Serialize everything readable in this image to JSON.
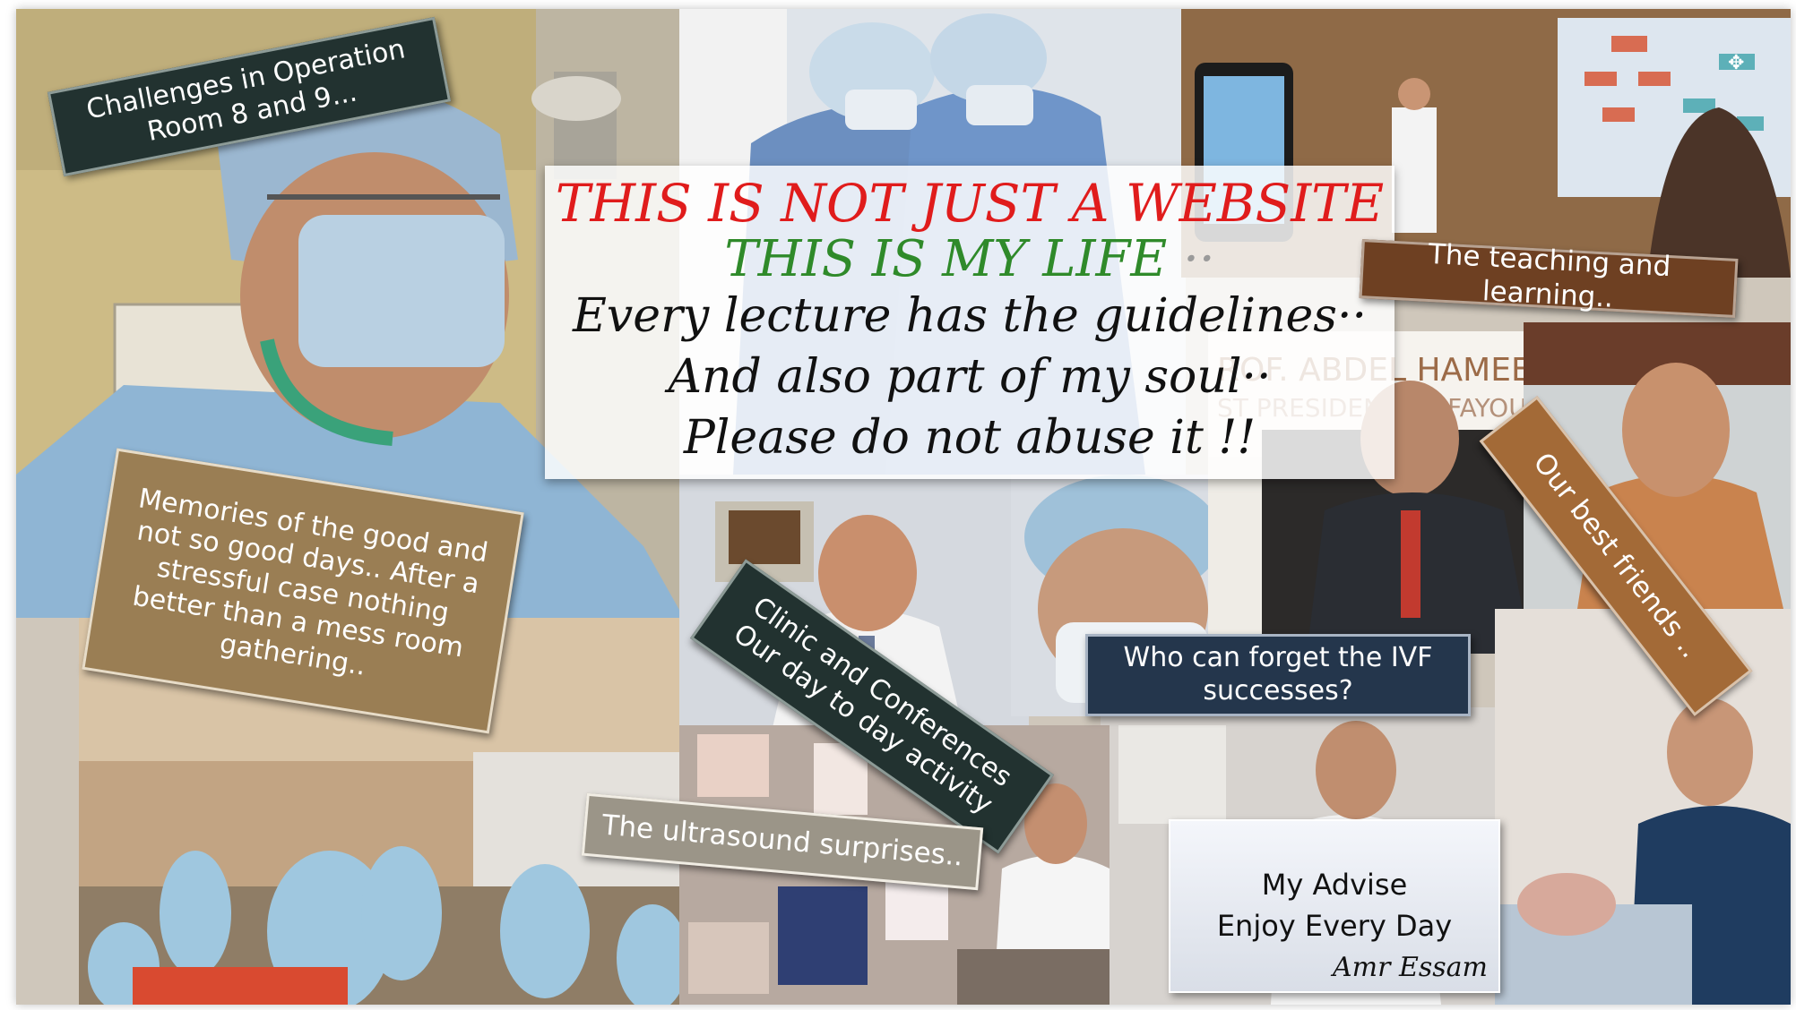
{
  "headline": {
    "line1": "THIS IS NOT JUST A WEBSITE",
    "line2": "THIS IS MY LIFE",
    "line2_dots": "··",
    "line3": "Every lecture has the guidelines··",
    "line4": "And also part of my soul··",
    "line5": "Please do not abuse it !!",
    "colors": {
      "line1": "#e01c1c",
      "line2": "#2f8a2a",
      "body": "#111111"
    }
  },
  "captions": {
    "operation_room": "Challenges in Operation Room 8 and 9...",
    "teaching": "The teaching and learning..",
    "memories": "Memories of the good and not so good days.. After a stressful case nothing better than a mess room gathering..",
    "friends": "Our best friends ..",
    "clinic": "Clinic and Conferences Our day to day activity",
    "ivf": "Who can forget the IVF successes?",
    "ultrasound": "The ultrasound surprises.."
  },
  "advise": {
    "line1": "My Advise",
    "line2": "Enjoy Every Day",
    "signature": "Amr Essam"
  },
  "background_text": {
    "banner_fragment_1": "ROF. ABDEL HAMEED ABD",
    "banner_fragment_2": "ST PRESIDENT OF FAYOUM U"
  },
  "icons": [
    "move-cursor-icon"
  ]
}
